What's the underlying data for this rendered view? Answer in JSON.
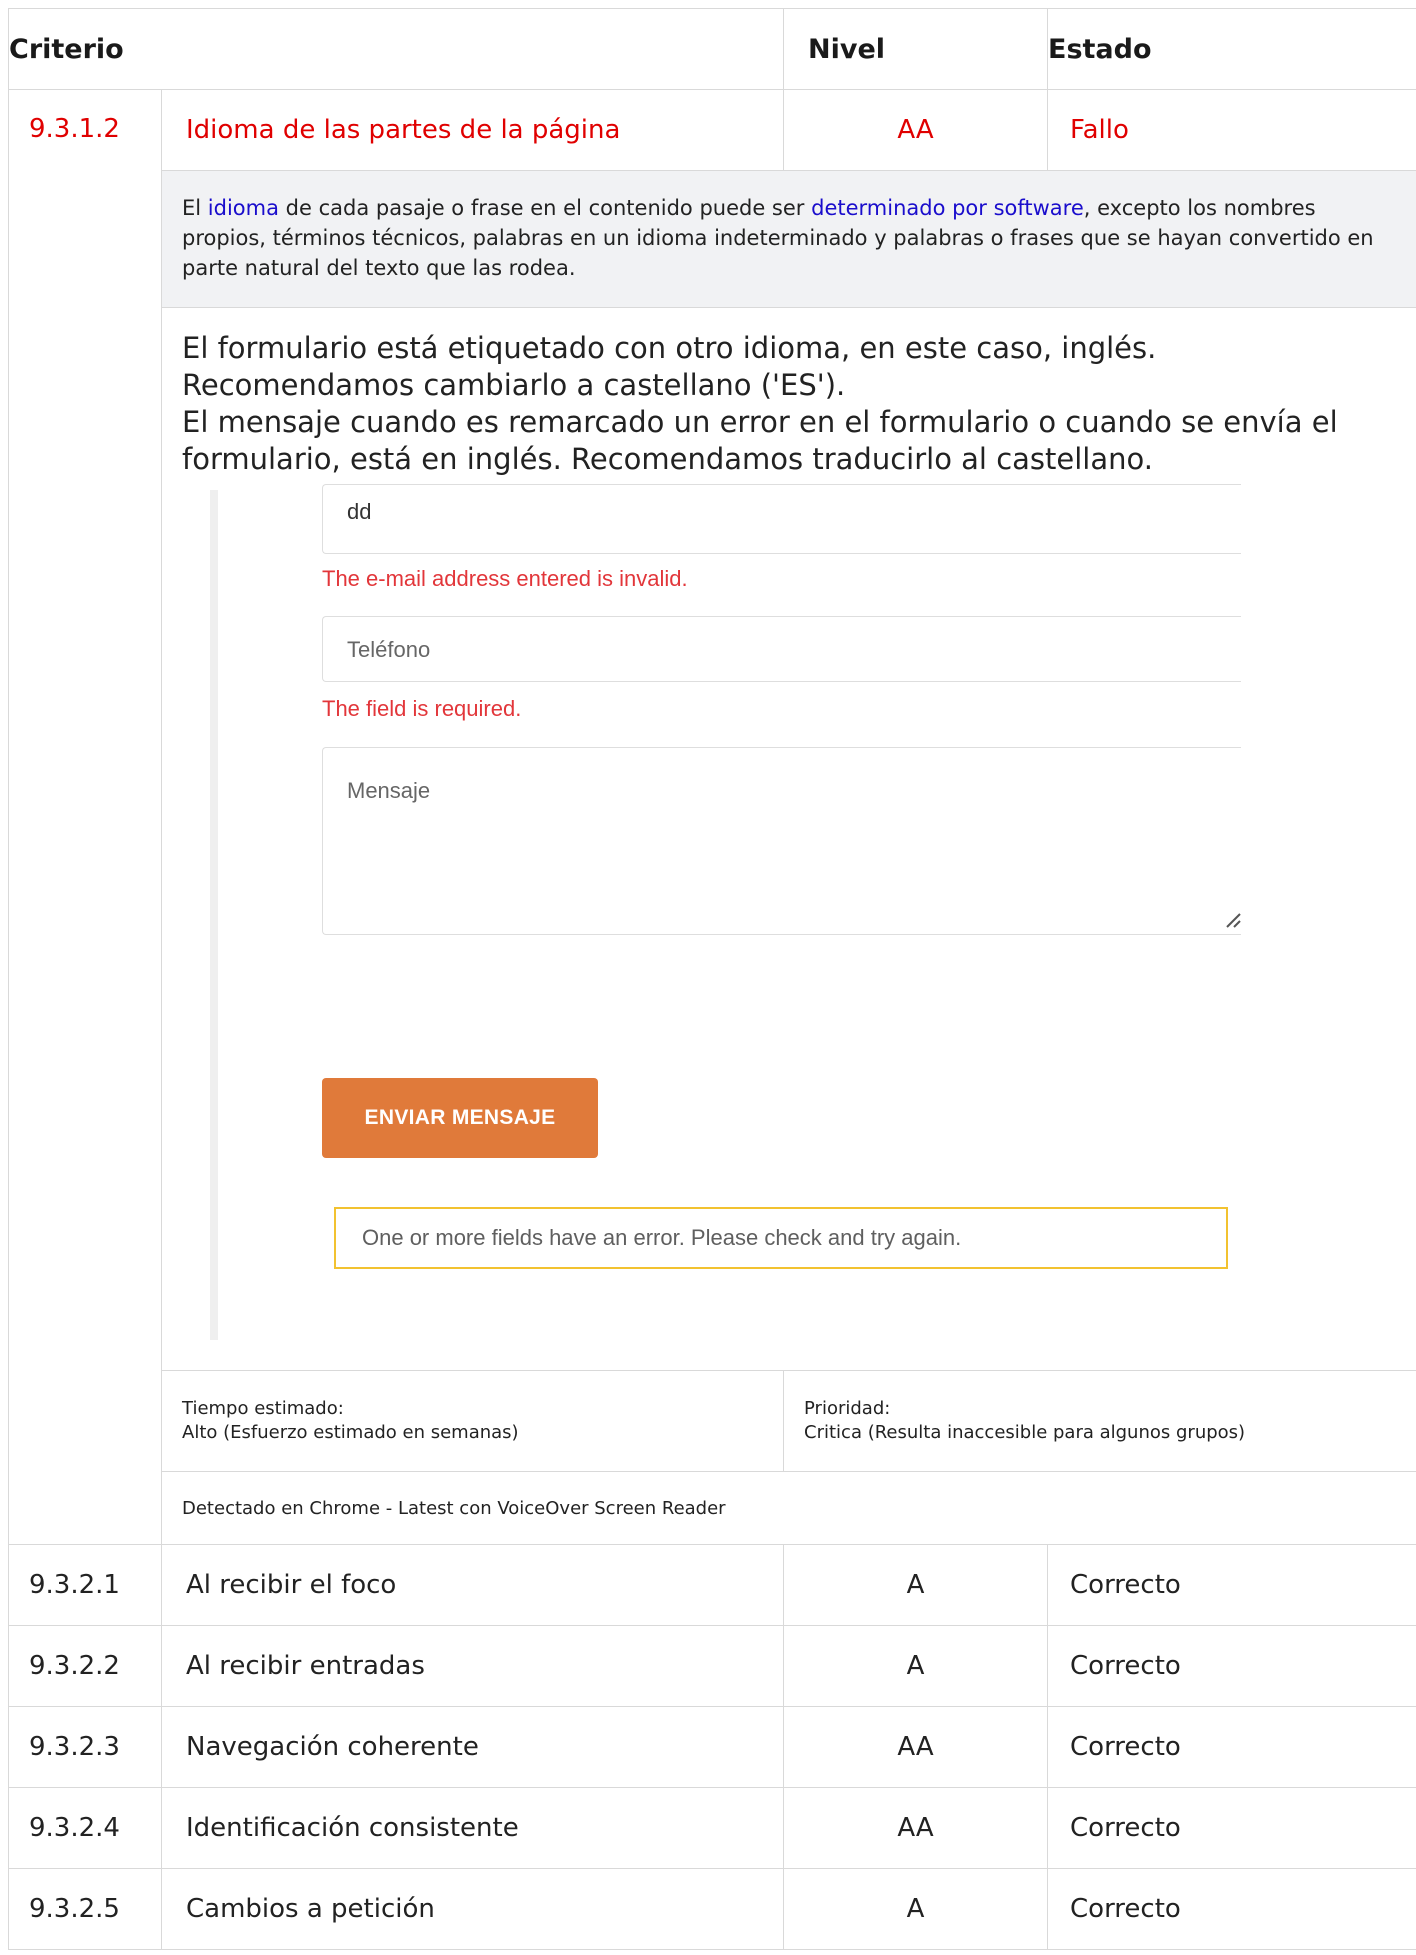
{
  "table": {
    "headers": {
      "criterio": "Criterio",
      "nivel": "Nivel",
      "estado": "Estado"
    },
    "failing": {
      "code": "9.3.1.2",
      "name": "Idioma de las partes de la página",
      "level": "AA",
      "status": "Fallo",
      "description": {
        "p1": "El ",
        "link1": "idioma",
        "p2": " de cada pasaje o frase en el contenido puede ser ",
        "link2": "determinado por software",
        "p3": ", excepto los nombres propios, términos técnicos, palabras en un idioma indeterminado y palabras o frases que se hayan convertido en parte natural del texto que las rodea."
      },
      "observation": [
        "El formulario está etiquetado con otro idioma, en este caso, inglés.",
        "Recomendamos cambiarlo a castellano ('ES').",
        "El mensaje cuando es remarcado un error en el formulario o cuando se envía el formulario, está en inglés. Recomendamos traducirlo al castellano."
      ],
      "screenshot": {
        "email_value": "dd",
        "email_error": "The e-mail address entered is invalid.",
        "phone_placeholder": "Teléfono",
        "phone_error": "The field is required.",
        "message_placeholder": "Mensaje",
        "send_button": "ENVIAR MENSAJE",
        "form_error": "One or more fields have an error. Please check and try again."
      },
      "time_label": "Tiempo estimado:",
      "time_value": "Alto (Esfuerzo estimado en semanas)",
      "priority_label": "Prioridad:",
      "priority_value": "Critica (Resulta inaccesible para algunos grupos)",
      "detected": "Detectado en Chrome - Latest con VoiceOver Screen Reader"
    },
    "rows": [
      {
        "code": "9.3.2.1",
        "name": "Al recibir el foco",
        "level": "A",
        "status": "Correcto"
      },
      {
        "code": "9.3.2.2",
        "name": "Al recibir entradas",
        "level": "A",
        "status": "Correcto"
      },
      {
        "code": "9.3.2.3",
        "name": "Navegación coherente",
        "level": "AA",
        "status": "Correcto"
      },
      {
        "code": "9.3.2.4",
        "name": "Identificación consistente",
        "level": "AA",
        "status": "Correcto"
      },
      {
        "code": "9.3.2.5",
        "name": "Cambios a petición",
        "level": "A",
        "status": "Correcto"
      }
    ]
  },
  "colors": {
    "fail": "#e00000",
    "link": "#1a0dcc",
    "button": "#e07a3a",
    "warning_border": "#f2c230",
    "error_text": "#e2363a"
  }
}
